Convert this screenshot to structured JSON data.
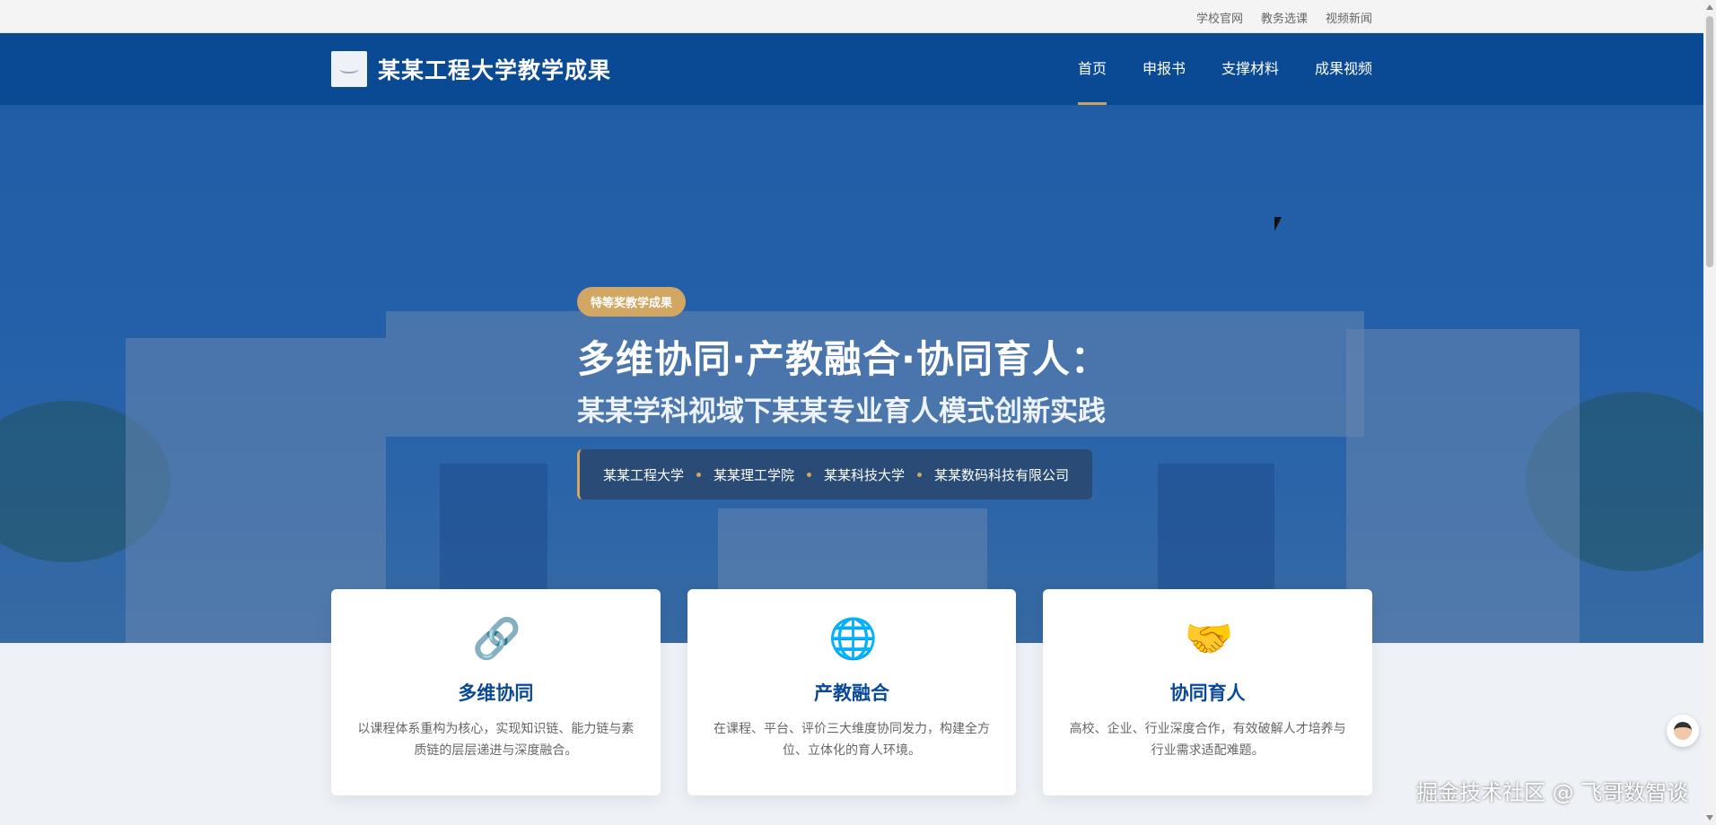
{
  "topbar": {
    "links": [
      "学校官网",
      "教务选课",
      "视频新闻"
    ]
  },
  "header": {
    "title": "某某工程大学教学成果",
    "nav": [
      {
        "label": "首页",
        "active": true
      },
      {
        "label": "申报书",
        "active": false
      },
      {
        "label": "支撑材料",
        "active": false
      },
      {
        "label": "成果视频",
        "active": false
      }
    ]
  },
  "hero": {
    "badge": "特等奖教学成果",
    "title": "多维协同·产教融合·协同育人：",
    "subtitle": "某某学科视域下某某专业育人模式创新实践",
    "partners": [
      "某某工程大学",
      "某某理工学院",
      "某某科技大学",
      "某某数码科技有限公司"
    ]
  },
  "cards": [
    {
      "icon": "link-icon",
      "glyph": "🔗",
      "title": "多维协同",
      "desc": "以课程体系重构为核心，实现知识链、能力链与素质链的层层递进与深度融合。"
    },
    {
      "icon": "globe-icon",
      "glyph": "🌐",
      "title": "产教融合",
      "desc": "在课程、平台、评价三大维度协同发力，构建全方位、立体化的育人环境。"
    },
    {
      "icon": "handshake-icon",
      "glyph": "🤝",
      "title": "协同育人",
      "desc": "高校、企业、行业深度合作，有效破解人才培养与行业需求适配难题。"
    }
  ],
  "watermark": "掘金技术社区 @ 飞哥数智谈",
  "colors": {
    "primary": "#0a4a94",
    "accent": "#d2a763"
  }
}
